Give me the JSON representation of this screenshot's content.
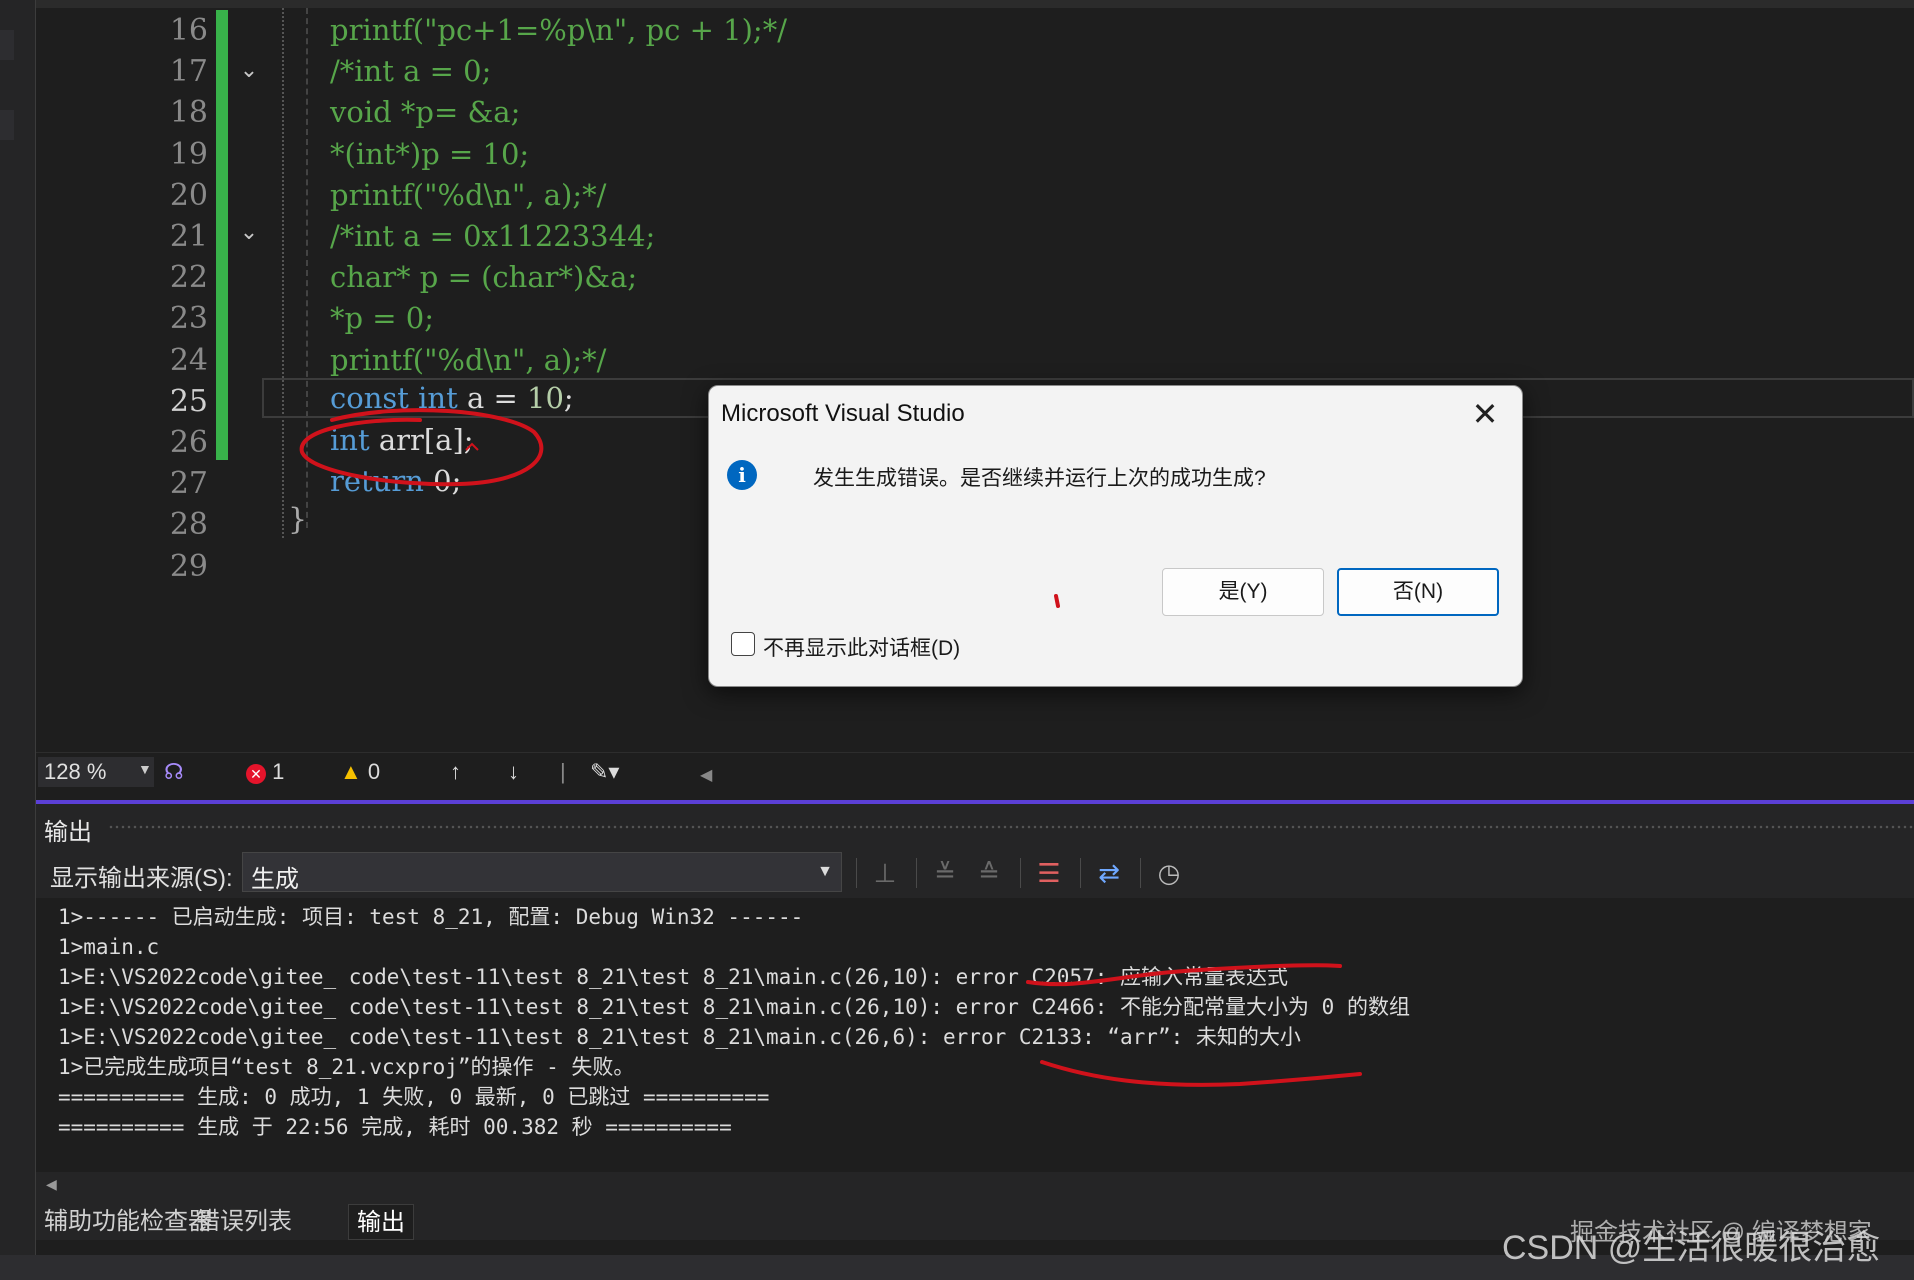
{
  "editor": {
    "line_numbers": [
      "16",
      "17",
      "18",
      "19",
      "20",
      "21",
      "22",
      "23",
      "24",
      "25",
      "26",
      "27",
      "28",
      "29"
    ],
    "current_line": "25",
    "lines": [
      {
        "type": "comment",
        "text": "printf(\"pc+1=%p\\n\", pc + 1);*/"
      },
      {
        "type": "comment",
        "text": "/*int a = 0;"
      },
      {
        "type": "comment",
        "text": "void *p= &a;"
      },
      {
        "type": "comment",
        "text": "*(int*)p = 10;"
      },
      {
        "type": "comment",
        "text": "printf(\"%d\\n\", a);*/"
      },
      {
        "type": "comment",
        "text": "/*int a = 0x11223344;"
      },
      {
        "type": "comment",
        "text": "char* p = (char*)&a;"
      },
      {
        "type": "comment",
        "text": "*p = 0;"
      },
      {
        "type": "comment",
        "text": "printf(\"%d\\n\", a);*/"
      }
    ],
    "line25": {
      "kw1": "const",
      "kw2": "int",
      "rest": " a = ",
      "num": "10",
      "tail": ";"
    },
    "line26": {
      "kw": "int",
      "rest": " arr[a];"
    },
    "line27": {
      "kw": "return",
      "rest": " 0;"
    },
    "closing_brace": "}"
  },
  "status": {
    "zoom": "128 %",
    "errors": "1",
    "warnings": "0"
  },
  "output": {
    "title": "输出",
    "source_label": "显示输出来源(S):",
    "source_value": "生成",
    "log": [
      "1>------ 已启动生成: 项目: test 8_21, 配置: Debug Win32 ------",
      "1>main.c",
      "1>E:\\VS2022code\\gitee_ code\\test-11\\test 8_21\\test 8_21\\main.c(26,10): error C2057: 应输入常量表达式",
      "1>E:\\VS2022code\\gitee_ code\\test-11\\test 8_21\\test 8_21\\main.c(26,10): error C2466: 不能分配常量大小为 0 的数组",
      "1>E:\\VS2022code\\gitee_ code\\test-11\\test 8_21\\test 8_21\\main.c(26,6): error C2133: “arr”: 未知的大小",
      "1>已完成生成项目“test 8_21.vcxproj”的操作 - 失败。",
      "========== 生成: 0 成功, 1 失败, 0 最新, 0 已跳过 ==========",
      "========== 生成 于 22:56 完成, 耗时 00.382 秒 =========="
    ]
  },
  "bottom_tabs": [
    "辅助功能检查器",
    "错误列表",
    "输出"
  ],
  "dialog": {
    "title": "Microsoft Visual Studio",
    "message": "发生生成错误。是否继续并运行上次的成功生成?",
    "yes_label": "是(Y)",
    "no_label": "否(N)",
    "checkbox_label": "不再显示此对话框(D)"
  },
  "watermark": {
    "main": "CSDN @生活很暖很治愈",
    "secondary": "掘金技术社区 @ 编译梦想家"
  },
  "icons": {
    "error": "error-circle-icon",
    "warning": "warning-triangle-icon",
    "info": "info-icon"
  },
  "colors": {
    "accent": "#5b3fd6",
    "change_bar": "#38b24a",
    "comment": "#57a64a",
    "keyword": "#569cd6",
    "annotation": "#d0121b"
  }
}
